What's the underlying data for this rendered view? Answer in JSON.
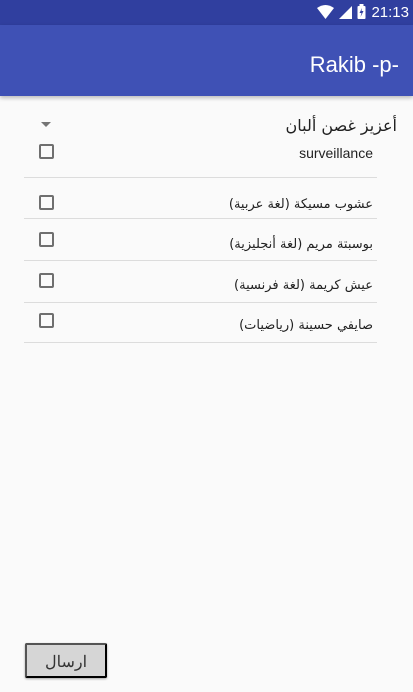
{
  "status": {
    "time": "21:13",
    "icons": [
      "wifi-icon",
      "signal-icon",
      "battery-icon"
    ]
  },
  "app": {
    "title": "Rakib -p-",
    "primary_color": "#3f51b5",
    "status_color": "#303f9f"
  },
  "dropdown": {
    "selected": "أعزيز غصن ألبان"
  },
  "items": [
    {
      "label": "surveillance",
      "checked": false
    },
    {
      "label": "عشوب مسيكة (لغة عربية)",
      "checked": false
    },
    {
      "label": "بوسبتة مريم (لغة أنجليزية)",
      "checked": false
    },
    {
      "label": "عيش كريمة (لغة فرنسية)",
      "checked": false
    },
    {
      "label": "صايفي حسينة (رياضيات)",
      "checked": false
    }
  ],
  "actions": {
    "submit_label": "ارسال"
  }
}
